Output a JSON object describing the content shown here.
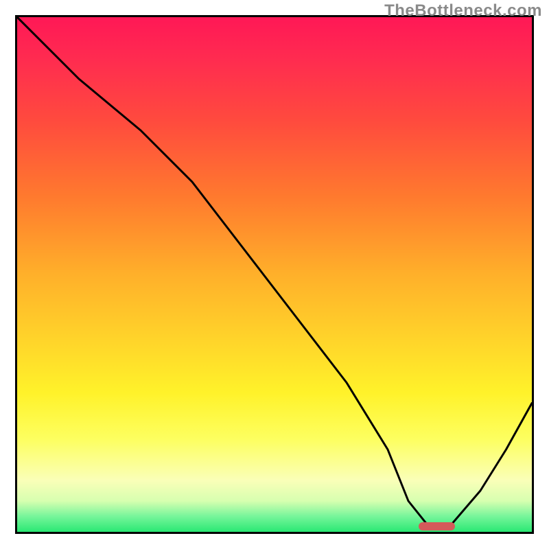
{
  "watermark": "TheBottleneck.com",
  "chart_data": {
    "type": "line",
    "title": "",
    "xlabel": "",
    "ylabel": "",
    "xlim": [
      0,
      100
    ],
    "ylim": [
      0,
      100
    ],
    "grid": false,
    "series": [
      {
        "name": "bottleneck-curve",
        "x": [
          0,
          12,
          24,
          34,
          44,
          54,
          64,
          72,
          76,
          80,
          84,
          90,
          95,
          100
        ],
        "values": [
          100,
          88,
          78,
          68,
          55,
          42,
          29,
          16,
          6,
          1,
          1,
          8,
          16,
          25
        ]
      }
    ],
    "annotations": [
      {
        "name": "optimal-range",
        "x_start": 78,
        "x_end": 85,
        "y": 0
      }
    ],
    "gradient_stops": [
      {
        "pos": 0.0,
        "color": "#ff1856"
      },
      {
        "pos": 0.2,
        "color": "#ff4a3e"
      },
      {
        "pos": 0.5,
        "color": "#ffb02a"
      },
      {
        "pos": 0.73,
        "color": "#fff22a"
      },
      {
        "pos": 0.9,
        "color": "#faffb8"
      },
      {
        "pos": 1.0,
        "color": "#2ae874"
      }
    ]
  }
}
